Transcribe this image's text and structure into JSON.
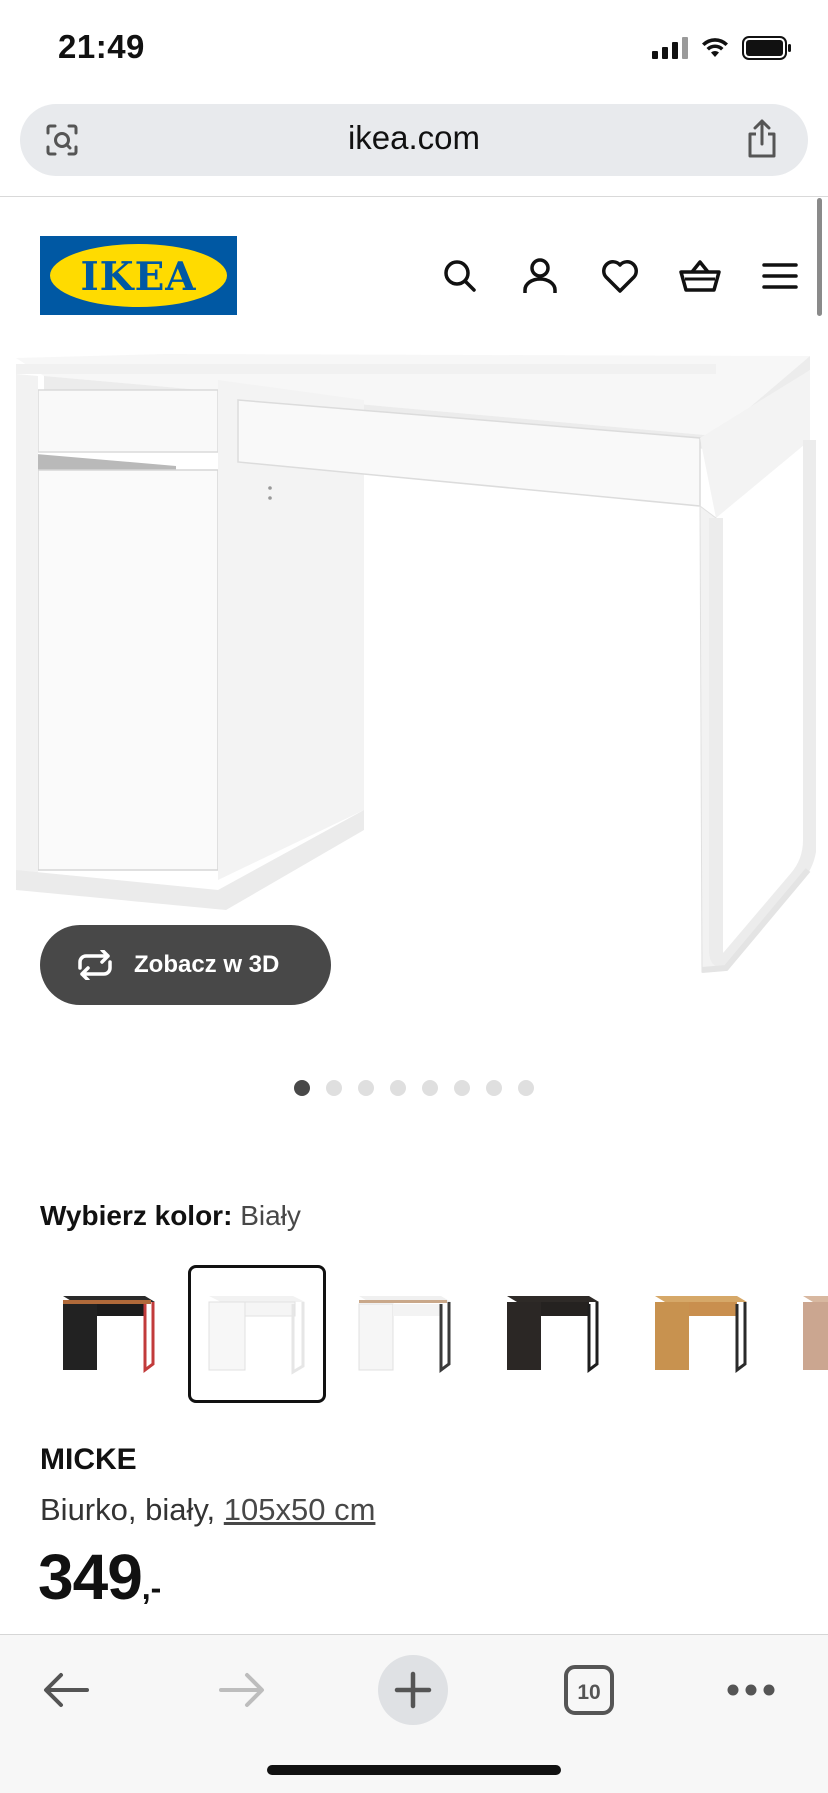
{
  "status_bar": {
    "time": "21:49"
  },
  "browser": {
    "url": "ikea.com"
  },
  "header": {
    "logo_text": "IKEA",
    "logo_colors": {
      "blue": "#0058a3",
      "yellow": "#ffdb00"
    }
  },
  "product": {
    "view_3d_label": "Zobacz w 3D",
    "gallery": {
      "total_images": 8,
      "current_index": 0
    },
    "color_label": "Wybierz kolor:",
    "color_value": "Biały",
    "color_options": [
      "black-red",
      "white",
      "white-grey",
      "black-brown",
      "oak",
      "light-wood"
    ],
    "selected_color_index": 1,
    "name": "MICKE",
    "description_prefix": "Biurko, biały, ",
    "size": "105x50 cm",
    "price_int": "349",
    "price_suffix": ",-"
  },
  "toolbar": {
    "tab_count": "10"
  },
  "colors": {
    "button_dark": "#484848",
    "address_bar": "#e8eaed"
  }
}
